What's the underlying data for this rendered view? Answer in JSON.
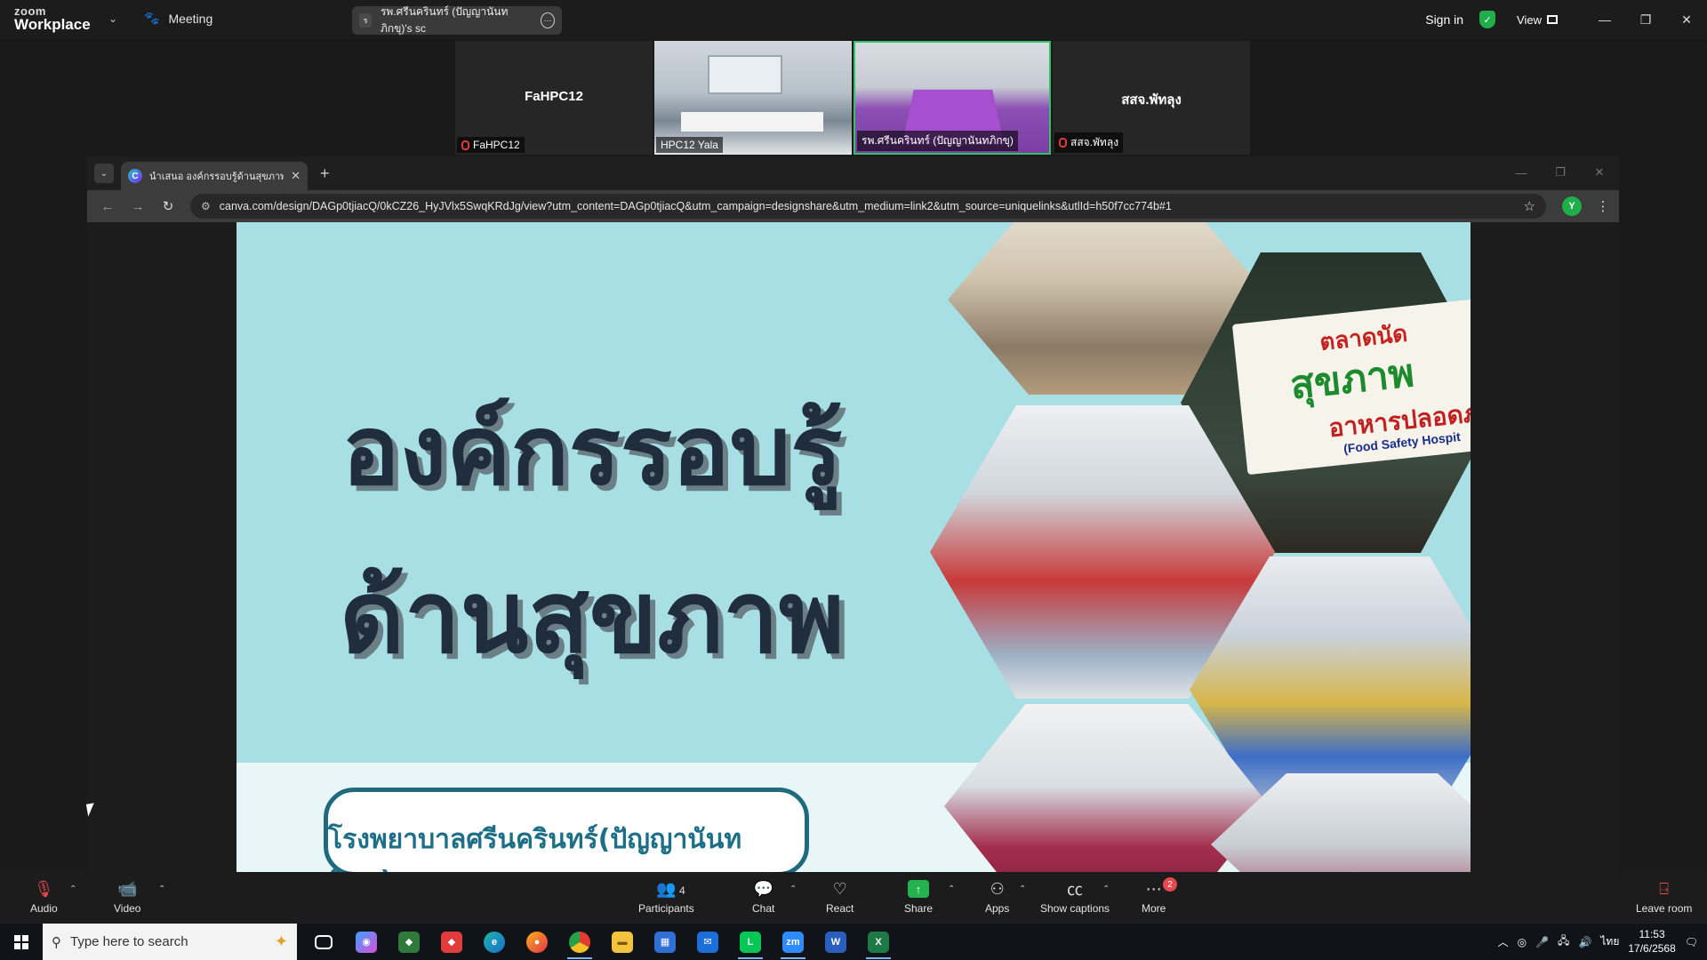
{
  "zoom_top": {
    "brand_small": "zoom",
    "brand_large": "Workplace",
    "meeting_label": "Meeting",
    "share_pill_avatar": "ร",
    "share_pill_text": "รพ.ศรีนครินทร์ (ปัญญานันทภิกขุ)'s sc",
    "sign_in": "Sign in",
    "view_label": "View",
    "icons": [
      "chevron-down-icon",
      "paw-icon",
      "more-icon",
      "shield-check-icon",
      "grid-icon",
      "minimize-icon",
      "maximize-icon",
      "close-icon"
    ]
  },
  "participants_strip": [
    {
      "big_name": "FaHPC12",
      "label": "FaHPC12",
      "muted": true,
      "video": false
    },
    {
      "big_name": "",
      "label": "HPC12 Yala",
      "muted": false,
      "video": true
    },
    {
      "big_name": "",
      "label": "รพ.ศรีนครินทร์ (ปัญญานันทภิกขุ)",
      "muted": false,
      "video": true,
      "active_speaker": true
    },
    {
      "big_name": "สสจ.พัทลุง",
      "label": "สสจ.พัทลุง",
      "muted": true,
      "video": false
    }
  ],
  "browser": {
    "tab_title": "นำเสนอ องค์กรรอบรู้ด้านสุขภาพ โร",
    "tab_favicon": "C",
    "url": "canva.com/design/DAGp0tjiacQ/0kCZ26_HyJVlx5SwqKRdJg/view?utm_content=DAGp0tjiacQ&utm_campaign=designshare&utm_medium=link2&utm_source=uniquelinks&utlId=h50f7cc774b#1",
    "extension_badge": "Y"
  },
  "slide": {
    "title_line1": "องค์กรรอบรู้",
    "title_line2": "ด้านสุขภาพ",
    "hospital_name": "โรงพยาบาลศรีนครินทร์(ปัญญานันทภิกขุ)",
    "banner_line1": "ตลาดนัด",
    "banner_line2": "สุขภาพ",
    "banner_line3": "อาหารปลอดภ",
    "banner_line4": "(Food Safety Hospit"
  },
  "zoom_bottom": {
    "audio": "Audio",
    "video": "Video",
    "participants": "Participants",
    "participants_count": "4",
    "chat": "Chat",
    "react": "React",
    "share": "Share",
    "apps": "Apps",
    "captions": "Show captions",
    "more": "More",
    "more_badge": "2",
    "leave": "Leave room"
  },
  "taskbar": {
    "search_placeholder": "Type here to search",
    "lang": "ไทย",
    "time": "11:53",
    "date": "17/6/2568",
    "pinned_icons": [
      "task-view-icon",
      "copilot-icon",
      "app-icon",
      "anydesk-icon",
      "edge-icon",
      "firefox-icon",
      "chrome-icon",
      "file-explorer-icon",
      "store-icon",
      "mail-icon",
      "line-icon",
      "zoom-icon",
      "word-icon",
      "excel-icon"
    ]
  },
  "colors": {
    "zoom_bg": "#1c1c1c",
    "active_speaker_border": "#35c06a",
    "share_green": "#24b24d",
    "mute_red": "#e5484d",
    "slide_bg": "#a7dfe5",
    "slide_title": "#1f2d3d",
    "hospital_text": "#1d6f88"
  }
}
